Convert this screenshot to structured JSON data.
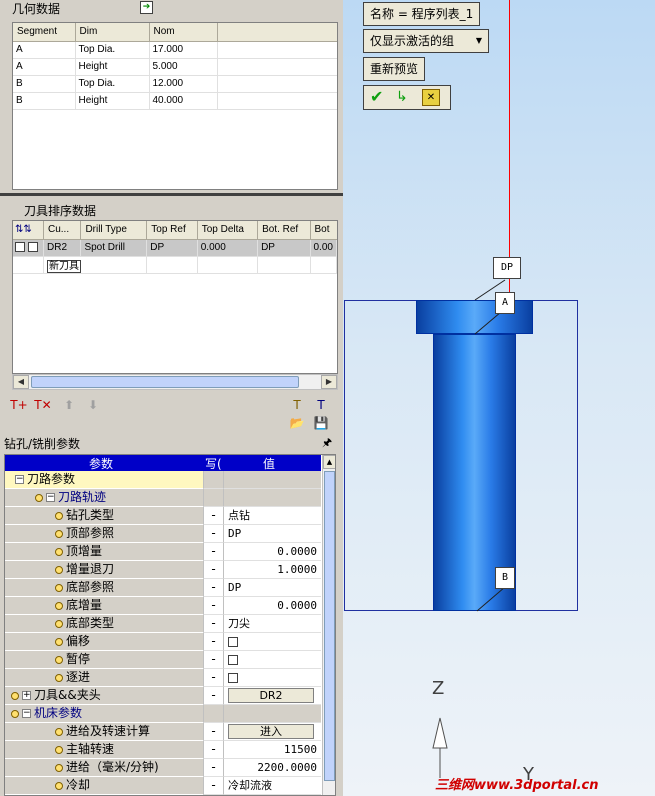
{
  "geometry": {
    "title": "几何数据",
    "columns": [
      "Segment",
      "Dim",
      "Nom"
    ],
    "rows": [
      [
        "A",
        "Top Dia.",
        "17.000"
      ],
      [
        "A",
        "Height",
        "5.000"
      ],
      [
        "B",
        "Top Dia.",
        "12.000"
      ],
      [
        "B",
        "Height",
        "40.000"
      ]
    ]
  },
  "tool_order": {
    "title": "刀具排序数据",
    "columns": [
      "Cu...",
      "Drill Type",
      "Top Ref",
      "Top Delta",
      "Bot. Ref",
      "Bot"
    ],
    "row": {
      "cu": "DR2",
      "drill_type": "Spot Drill",
      "top_ref": "DP",
      "top_delta": "0.000",
      "bot_ref": "DP",
      "bot": "0.00"
    },
    "new_tool": "新刀具"
  },
  "params_panel": {
    "title": "钻孔/铣削参数",
    "pin": "ᵖ",
    "col_param": "参数",
    "col_write": "写(",
    "col_value": "值",
    "rows": [
      {
        "name": "刀路参数",
        "w": "",
        "v": ""
      },
      {
        "name": "刀路轨迹",
        "w": "",
        "v": ""
      },
      {
        "name": "钻孔类型",
        "w": "-",
        "v": "点钻"
      },
      {
        "name": "顶部参照",
        "w": "-",
        "v": "DP"
      },
      {
        "name": "顶增量",
        "w": "-",
        "v": "0.0000"
      },
      {
        "name": "增量退刀",
        "w": "-",
        "v": "1.0000"
      },
      {
        "name": "底部参照",
        "w": "-",
        "v": "DP"
      },
      {
        "name": "底增量",
        "w": "-",
        "v": "0.0000"
      },
      {
        "name": "底部类型",
        "w": "-",
        "v": "刀尖"
      },
      {
        "name": "偏移",
        "w": "-",
        "v": ""
      },
      {
        "name": "暂停",
        "w": "-",
        "v": ""
      },
      {
        "name": "逐进",
        "w": "-",
        "v": ""
      },
      {
        "name": "刀具&&夹头",
        "w": "-",
        "v": "DR2"
      },
      {
        "name": "机床参数",
        "w": "",
        "v": ""
      },
      {
        "name": "进给及转速计算",
        "w": "-",
        "v": "进入"
      },
      {
        "name": "主轴转速",
        "w": "-",
        "v": "11500"
      },
      {
        "name": "进给（毫米/分钟)",
        "w": "-",
        "v": "2200.0000"
      },
      {
        "name": "冷却",
        "w": "-",
        "v": "冷却流液"
      }
    ]
  },
  "view": {
    "name_button": "名称 = 程序列表_1",
    "filter_dropdown": "仅显示激活的组",
    "preview_button": "重新预览",
    "tag_dp": "DP",
    "tag_a": "A",
    "tag_b": "B",
    "axis_z": "Z",
    "axis_y": "Y",
    "watermark": "三维网www.3dportal.cn"
  },
  "colors": {
    "accent": "#0000c8",
    "cylinder": "#1f6fe0",
    "axis_line": "#ff0000"
  }
}
